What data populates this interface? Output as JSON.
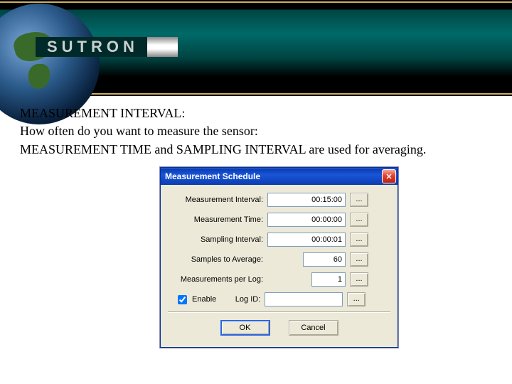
{
  "brand": "SUTRON",
  "slide": {
    "line1": "MEASUREMENT INTERVAL:",
    "line2": "How often do you want to measure the sensor:",
    "line3": "MEASUREMENT TIME and SAMPLING INTERVAL are used for averaging."
  },
  "dialog": {
    "title": "Measurement Schedule",
    "close_glyph": "✕",
    "fields": {
      "measurement_interval": {
        "label": "Measurement Interval:",
        "value": "00:15:00"
      },
      "measurement_time": {
        "label": "Measurement Time:",
        "value": "00:00:00"
      },
      "sampling_interval": {
        "label": "Sampling Interval:",
        "value": "00:00:01"
      },
      "samples_to_average": {
        "label": "Samples to Average:",
        "value": "60"
      },
      "measurements_per_log": {
        "label": "Measurements per Log:",
        "value": "1"
      },
      "enable": {
        "label": "Enable",
        "checked": true
      },
      "log_id": {
        "label": "Log ID:",
        "value": ""
      }
    },
    "ellipsis": "...",
    "buttons": {
      "ok": "OK",
      "cancel": "Cancel"
    }
  }
}
